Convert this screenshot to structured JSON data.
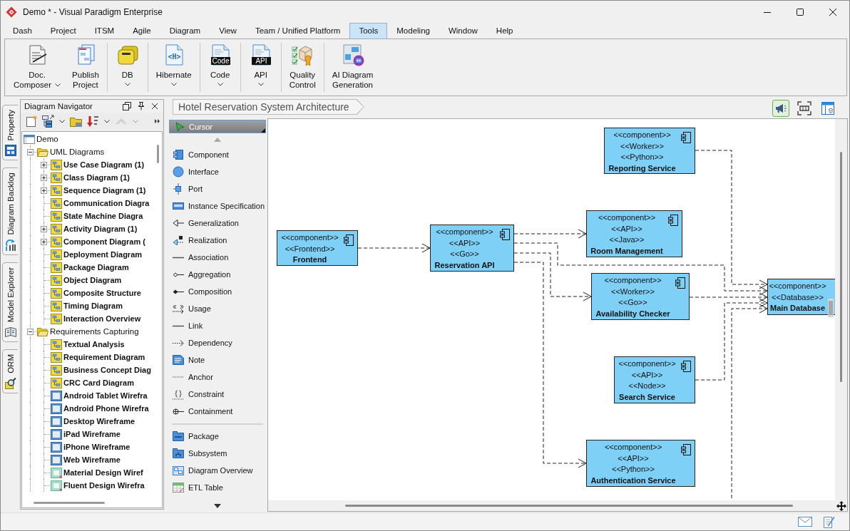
{
  "window": {
    "title": "Demo * - Visual Paradigm Enterprise"
  },
  "menu": [
    {
      "label": "Dash",
      "selected": false
    },
    {
      "label": "Project",
      "selected": false
    },
    {
      "label": "ITSM",
      "selected": false
    },
    {
      "label": "Agile",
      "selected": false
    },
    {
      "label": "Diagram",
      "selected": false
    },
    {
      "label": "View",
      "selected": false
    },
    {
      "label": "Team / Unified Platform",
      "selected": false
    },
    {
      "label": "Tools",
      "selected": true
    },
    {
      "label": "Modeling",
      "selected": false
    },
    {
      "label": "Window",
      "selected": false
    },
    {
      "label": "Help",
      "selected": false
    }
  ],
  "ribbon": [
    {
      "buttons": [
        {
          "kind": "document",
          "label": "Doc.\nComposer",
          "dropdown": true
        },
        {
          "kind": "publish",
          "label": "Publish\nProject",
          "dropdown": false
        }
      ]
    },
    {
      "buttons": [
        {
          "kind": "database",
          "label": "DB",
          "dropdown": true
        }
      ]
    },
    {
      "buttons": [
        {
          "kind": "hibernate",
          "label": "Hibernate",
          "dropdown": true,
          "icon_text": "<H>"
        }
      ]
    },
    {
      "buttons": [
        {
          "kind": "code",
          "label": "Code",
          "dropdown": true,
          "icon_text": "Code"
        }
      ]
    },
    {
      "buttons": [
        {
          "kind": "api",
          "label": "API",
          "dropdown": true,
          "icon_text": "API"
        }
      ]
    },
    {
      "buttons": [
        {
          "kind": "quality",
          "label": "Quality\nControl",
          "dropdown": false
        }
      ]
    },
    {
      "buttons": [
        {
          "kind": "ai",
          "label": "AI Diagram\nGeneration",
          "dropdown": false
        }
      ]
    }
  ],
  "side_tabs": [
    {
      "label": "Property",
      "kind": "property",
      "selected": false
    },
    {
      "label": "Diagram Backlog",
      "kind": "backlog",
      "selected": false
    },
    {
      "label": "Model Explorer",
      "kind": "explorer",
      "selected": false
    },
    {
      "label": "ORM",
      "kind": "orm",
      "selected": false
    }
  ],
  "navigator": {
    "title": "Diagram Navigator",
    "toolbar": [
      {
        "kind": "new",
        "dropdown": false,
        "disabled": false
      },
      {
        "kind": "layout",
        "dropdown": true,
        "disabled": false
      },
      {
        "kind": "folder",
        "dropdown": false,
        "disabled": false
      },
      {
        "kind": "sort",
        "dropdown": true,
        "disabled": false
      },
      {
        "kind": "up",
        "dropdown": true,
        "disabled": true
      }
    ],
    "tree": [
      {
        "label": "Demo",
        "kind": "project",
        "children": [
          {
            "label": "UML Diagrams",
            "kind": "folder",
            "expanded": true,
            "children": [
              {
                "label": "Use Case Diagram (1)",
                "kind": "diagram",
                "expanded": false
              },
              {
                "label": "Class Diagram (1)",
                "kind": "diagram",
                "expanded": false
              },
              {
                "label": "Sequence Diagram (1)",
                "kind": "diagram",
                "expanded": false
              },
              {
                "label": "Communication Diagra",
                "kind": "diagram"
              },
              {
                "label": "State Machine Diagra",
                "kind": "diagram"
              },
              {
                "label": "Activity Diagram (1)",
                "kind": "diagram",
                "expanded": false
              },
              {
                "label": "Component Diagram (",
                "kind": "diagram",
                "expanded": false
              },
              {
                "label": "Deployment Diagram",
                "kind": "diagram"
              },
              {
                "label": "Package Diagram",
                "kind": "diagram"
              },
              {
                "label": "Object Diagram",
                "kind": "diagram"
              },
              {
                "label": "Composite Structure",
                "kind": "diagram"
              },
              {
                "label": "Timing Diagram",
                "kind": "diagram"
              },
              {
                "label": "Interaction Overview",
                "kind": "diagram"
              }
            ]
          },
          {
            "label": "Requirements Capturing",
            "kind": "folder",
            "expanded": true,
            "children": [
              {
                "label": "Textual Analysis",
                "kind": "diagram"
              },
              {
                "label": "Requirement Diagram",
                "kind": "diagram"
              },
              {
                "label": "Business Concept Diag",
                "kind": "diagram"
              },
              {
                "label": "CRC Card Diagram",
                "kind": "diagram"
              },
              {
                "label": "Android Tablet Wirefra",
                "kind": "wireframe"
              },
              {
                "label": "Android Phone Wirefra",
                "kind": "wireframe"
              },
              {
                "label": "Desktop Wireframe",
                "kind": "wireframe"
              },
              {
                "label": "iPad Wireframe",
                "kind": "wireframe"
              },
              {
                "label": "iPhone Wireframe",
                "kind": "wireframe"
              },
              {
                "label": "Web Wireframe",
                "kind": "wireframe"
              },
              {
                "label": "Material Design Wiref",
                "kind": "design"
              },
              {
                "label": "Fluent Design Wirefra",
                "kind": "design"
              }
            ]
          }
        ]
      }
    ]
  },
  "palette": {
    "cursor": {
      "label": "Cursor",
      "selected": true
    },
    "groups": [
      {
        "items": [
          {
            "label": "Component",
            "kind": "component",
            "selected": false
          },
          {
            "label": "Interface",
            "kind": "interface",
            "selected": false
          },
          {
            "label": "Port",
            "kind": "port",
            "selected": false
          },
          {
            "label": "Instance Specification",
            "kind": "instance",
            "selected": false
          },
          {
            "label": "Generalization",
            "kind": "generalization",
            "selected": false
          },
          {
            "label": "Realization",
            "kind": "realization",
            "selected": false
          },
          {
            "label": "Association",
            "kind": "association",
            "selected": false
          },
          {
            "label": "Aggregation",
            "kind": "aggregation",
            "selected": false
          },
          {
            "label": "Composition",
            "kind": "composition",
            "selected": false
          },
          {
            "label": "Usage",
            "kind": "usage",
            "selected": false
          },
          {
            "label": "Link",
            "kind": "link",
            "selected": false
          },
          {
            "label": "Dependency",
            "kind": "dependency",
            "selected": false
          },
          {
            "label": "Note",
            "kind": "note",
            "selected": false
          },
          {
            "label": "Anchor",
            "kind": "anchor",
            "selected": false
          },
          {
            "label": "Constraint",
            "kind": "constraint",
            "selected": false
          },
          {
            "label": "Containment",
            "kind": "containment",
            "selected": false
          }
        ]
      },
      {
        "items": [
          {
            "label": "Package",
            "kind": "package",
            "selected": false
          },
          {
            "label": "Subsystem",
            "kind": "subsystem",
            "selected": false
          },
          {
            "label": "Diagram Overview",
            "kind": "overview",
            "selected": false
          },
          {
            "label": "ETL Table",
            "kind": "table",
            "selected": false
          }
        ]
      }
    ]
  },
  "diagram": {
    "tab": "Hotel Reservation System Architecture",
    "tools": [
      {
        "kind": "announce",
        "on": true
      },
      {
        "kind": "fit",
        "on": false
      },
      {
        "kind": "panel",
        "on": false
      }
    ],
    "components": [
      {
        "stereotypes": [
          "<<component>>",
          "<<Worker>>",
          "<<Python>>"
        ],
        "name": "Reporting Service"
      },
      {
        "stereotypes": [
          "<<component>>",
          "<<API>>",
          "<<Java>>"
        ],
        "name": "Room Management"
      },
      {
        "stereotypes": [
          "<<component>>",
          "<<Frontend>>"
        ],
        "name": "Frontend"
      },
      {
        "stereotypes": [
          "<<component>>",
          "<<API>>",
          "<<Go>>"
        ],
        "name": "Reservation API"
      },
      {
        "stereotypes": [
          "<<component>>",
          "<<Worker>>",
          "<<Go>>"
        ],
        "name": "Availability Checker"
      },
      {
        "stereotypes": [
          "<<component>>",
          "<<Database>>"
        ],
        "name": "Main Database"
      },
      {
        "stereotypes": [
          "<<component>>",
          "<<API>>",
          "<<Node>>"
        ],
        "name": "Search Service"
      },
      {
        "stereotypes": [
          "<<component>>",
          "<<API>>",
          "<<Python>>"
        ],
        "name": "Authentication Service"
      }
    ]
  }
}
